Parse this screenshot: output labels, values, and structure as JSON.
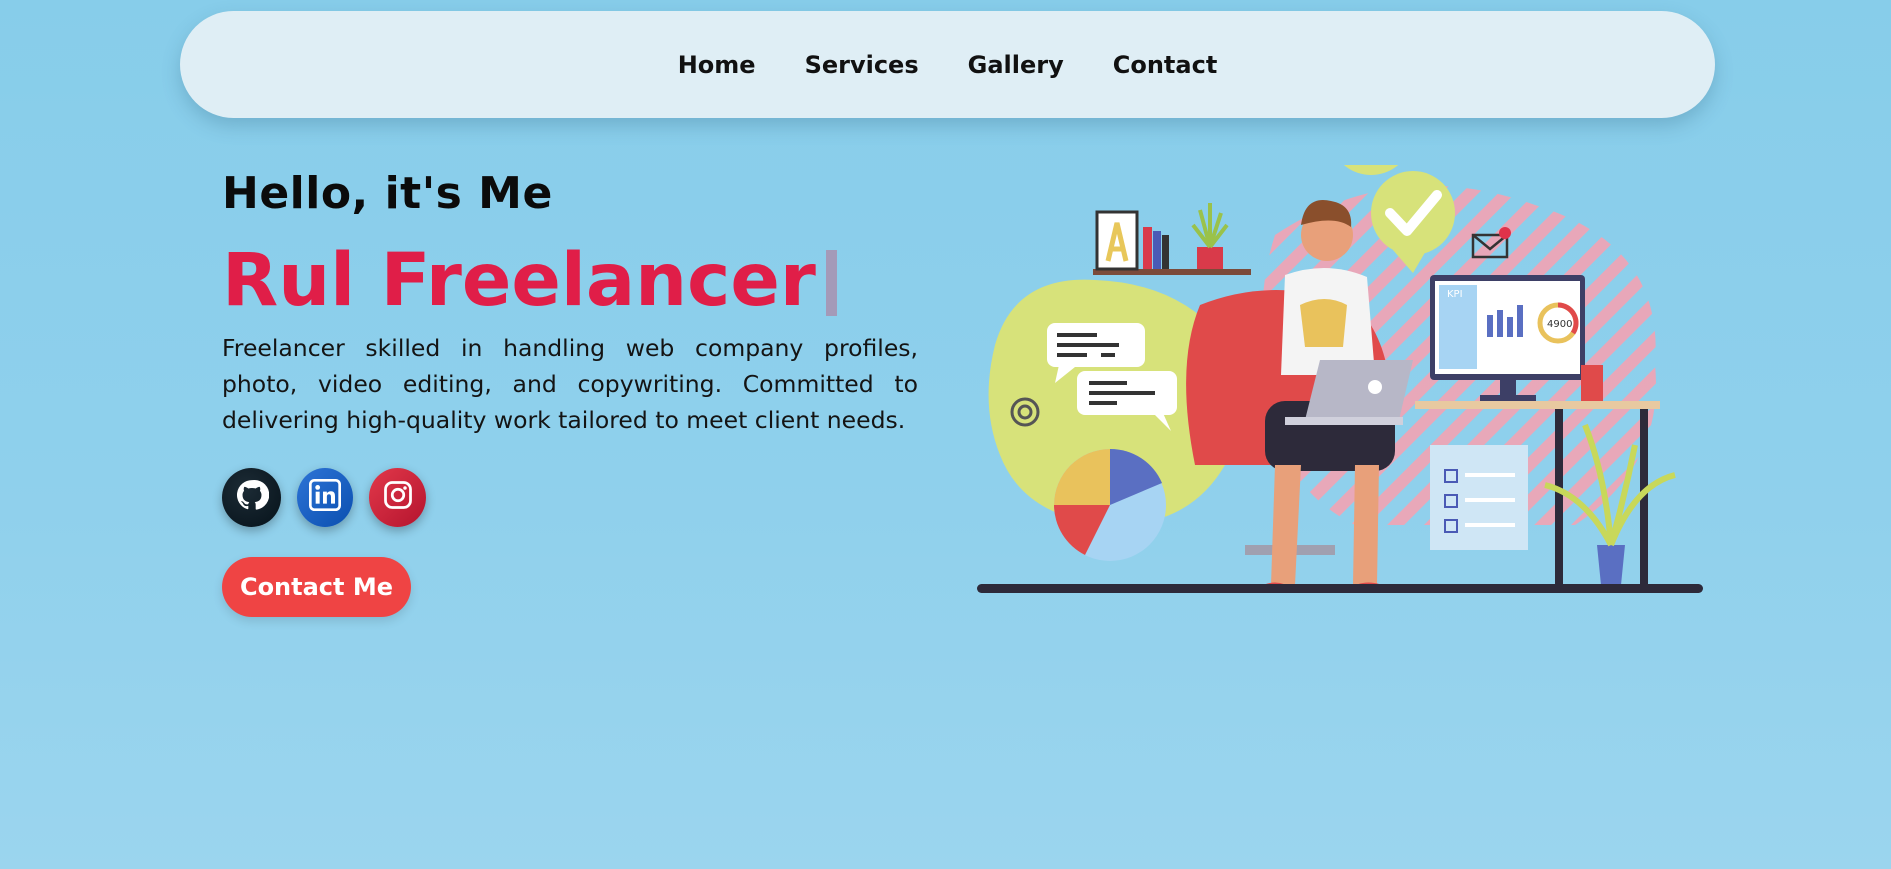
{
  "nav": {
    "links": [
      "Home",
      "Services",
      "Gallery",
      "Contact"
    ]
  },
  "hero": {
    "greeting": "Hello, it's Me",
    "role": "Rul Freelancer",
    "description": "Freelancer skilled in handling web company profiles, photo, video editing, and copywriting. Committed to delivering high-quality work tailored to meet client needs.",
    "cta_label": "Contact Me"
  },
  "socials": {
    "items": [
      {
        "name": "github",
        "icon": "github-icon"
      },
      {
        "name": "linkedin",
        "icon": "linkedin-icon"
      },
      {
        "name": "instagram",
        "icon": "instagram-icon"
      }
    ]
  },
  "illustration": {
    "kpi_label": "KPI",
    "gauge_value": "4900"
  },
  "colors": {
    "background": "#87cdea",
    "accent": "#e01e48",
    "cta": "#ef4444",
    "navbar": "#dfeef5"
  }
}
